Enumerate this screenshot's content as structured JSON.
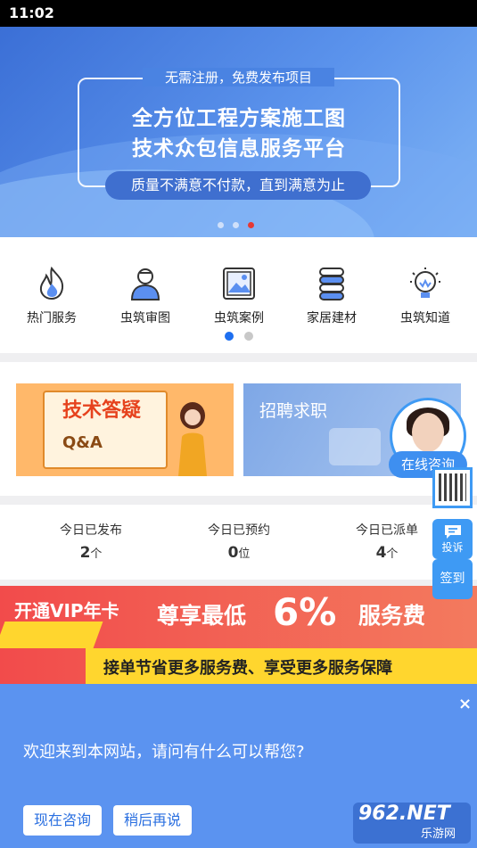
{
  "status_bar": {
    "time": "11:02"
  },
  "banner": {
    "subtitle": "无需注册，免费发布项目",
    "title_line1": "全方位工程方案施工图",
    "title_line2": "技术众包信息服务平台",
    "tagline": "质量不满意不付款，直到满意为止",
    "slide_count": 3,
    "active_slide": 3
  },
  "services": {
    "items": [
      {
        "label": "热门服务",
        "icon": "flame-icon"
      },
      {
        "label": "虫筑审图",
        "icon": "reviewer-icon"
      },
      {
        "label": "虫筑案例",
        "icon": "picture-icon"
      },
      {
        "label": "家居建材",
        "icon": "materials-icon"
      },
      {
        "label": "虫筑知道",
        "icon": "lightbulb-icon"
      }
    ],
    "page_count": 2,
    "active_page": 1
  },
  "promos": {
    "left": {
      "title": "技术答疑",
      "subtitle": "Q&A"
    },
    "right": {
      "title": "招聘求职"
    }
  },
  "stats": [
    {
      "label": "今日已发布",
      "value": "2",
      "unit": "个"
    },
    {
      "label": "今日已预约",
      "value": "0",
      "unit": "位"
    },
    {
      "label": "今日已派单",
      "value": "4",
      "unit": "个"
    }
  ],
  "vip_banner": {
    "left_text": "开通VIP年卡",
    "middle_text": "尊享最低",
    "percent": "6%",
    "right_text": "服务费",
    "band_text": "接单节省更多服务费、享受更多服务保障"
  },
  "sidebar": {
    "consult_label": "在线咨询",
    "report_label": "投诉",
    "sign_label": "签到"
  },
  "chat": {
    "close_symbol": "×",
    "message": "欢迎来到本网站，请问有什么可以帮您?",
    "consult_now": "现在咨询",
    "later": "稍后再说"
  },
  "watermark": {
    "brand": "962.NET",
    "name": "乐游网"
  },
  "colors": {
    "accent": "#3e9af4",
    "banner": "#5b93ec",
    "vip": "#f24b4b",
    "vip_band": "#ffd62e",
    "chat": "#5b93f0"
  }
}
